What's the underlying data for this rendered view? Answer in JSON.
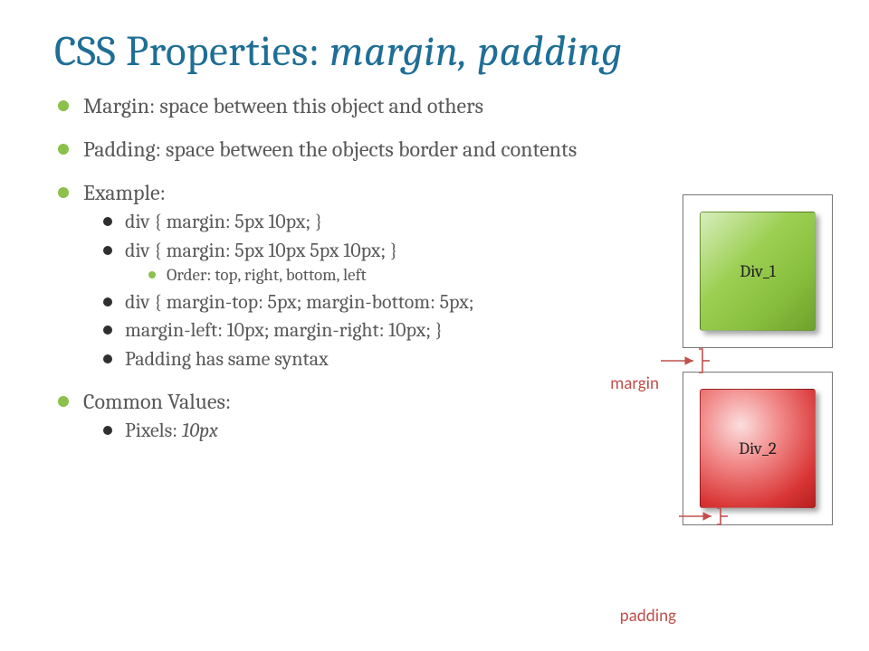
{
  "title_prefix": "CSS Properties: ",
  "title_italic": "margin, padding",
  "bullets": {
    "b1": "Margin: space between this object and others",
    "b2": "Padding: space between the objects border and contents",
    "b3": "Example:",
    "b3_1": "div { margin: 5px 10px; }",
    "b3_2": "div { margin: 5px 10px 5px 10px; }",
    "b3_2_1": "Order: top, right, bottom, left",
    "b3_3": "div { margin-top: 5px; margin-bottom: 5px;",
    "b3_4": "margin-left: 10px; margin-right: 10px; }",
    "b3_5": "Padding has same syntax",
    "b4": "Common Values:",
    "b4_1_a": "Pixels: ",
    "b4_1_b": "10px"
  },
  "diagram": {
    "box1_label": "Div_1",
    "box2_label": "Div_2",
    "margin_label": "margin",
    "padding_label": "padding"
  },
  "colors": {
    "title": "#1f6e96",
    "bullet_green": "#8bc04b",
    "callout_red": "#c0504d"
  }
}
